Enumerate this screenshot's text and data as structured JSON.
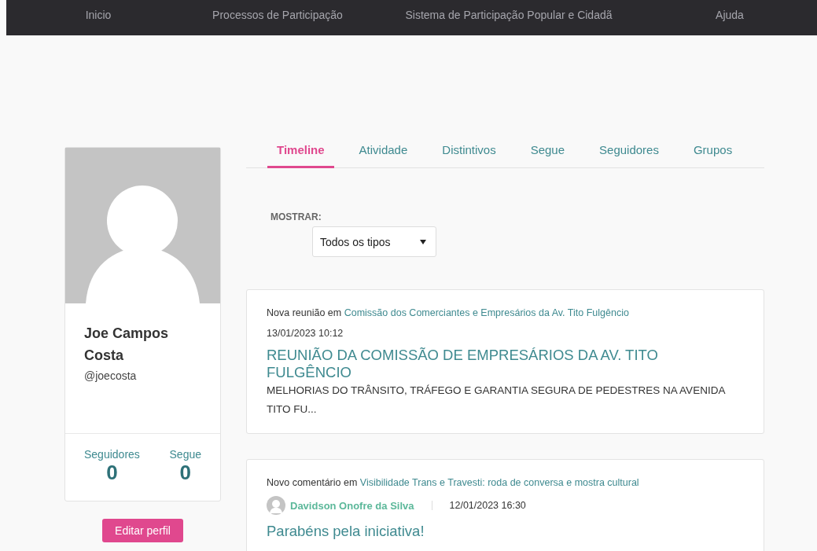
{
  "nav": [
    "Inicio",
    "Processos de Participação",
    "Sistema de Participação Popular e Cidadã",
    "Ajuda"
  ],
  "profile": {
    "name": "Joe Campos Costa",
    "handle": "@joecosta",
    "stats": [
      {
        "label": "Seguidores",
        "value": "0"
      },
      {
        "label": "Segue",
        "value": "0"
      }
    ],
    "edit_button": "Editar perfil"
  },
  "tabs": [
    {
      "label": "Timeline",
      "selected": true
    },
    {
      "label": "Atividade",
      "selected": false
    },
    {
      "label": "Distintivos",
      "selected": false
    },
    {
      "label": "Segue",
      "selected": false
    },
    {
      "label": "Seguidores",
      "selected": false
    },
    {
      "label": "Grupos",
      "selected": false
    }
  ],
  "filter": {
    "label": "MOSTRAR:",
    "value": "Todos os tipos"
  },
  "feed": [
    {
      "kind": "meeting",
      "prefix": "Nova reunião em",
      "link": "Comissão dos Comerciantes e Empresários da Av. Tito Fulgêncio",
      "date": "13/01/2023 10:12",
      "title": "REUNIÃO DA COMISSÃO DE EMPRESÁRIOS DA AV. TITO FULGÊNCIO",
      "body": "MELHORIAS DO TRÂNSITO, TRÁFEGO E GARANTIA SEGURA DE PEDESTRES NA AVENIDA TITO FU..."
    },
    {
      "kind": "comment",
      "prefix": "Novo comentário em",
      "link": "Visibilidade Trans e Travesti: roda de conversa e mostra cultural",
      "author": "Davidson Onofre da Silva",
      "date": "12/01/2023 16:30",
      "title": "Parabéns pela iniciativa!"
    }
  ]
}
